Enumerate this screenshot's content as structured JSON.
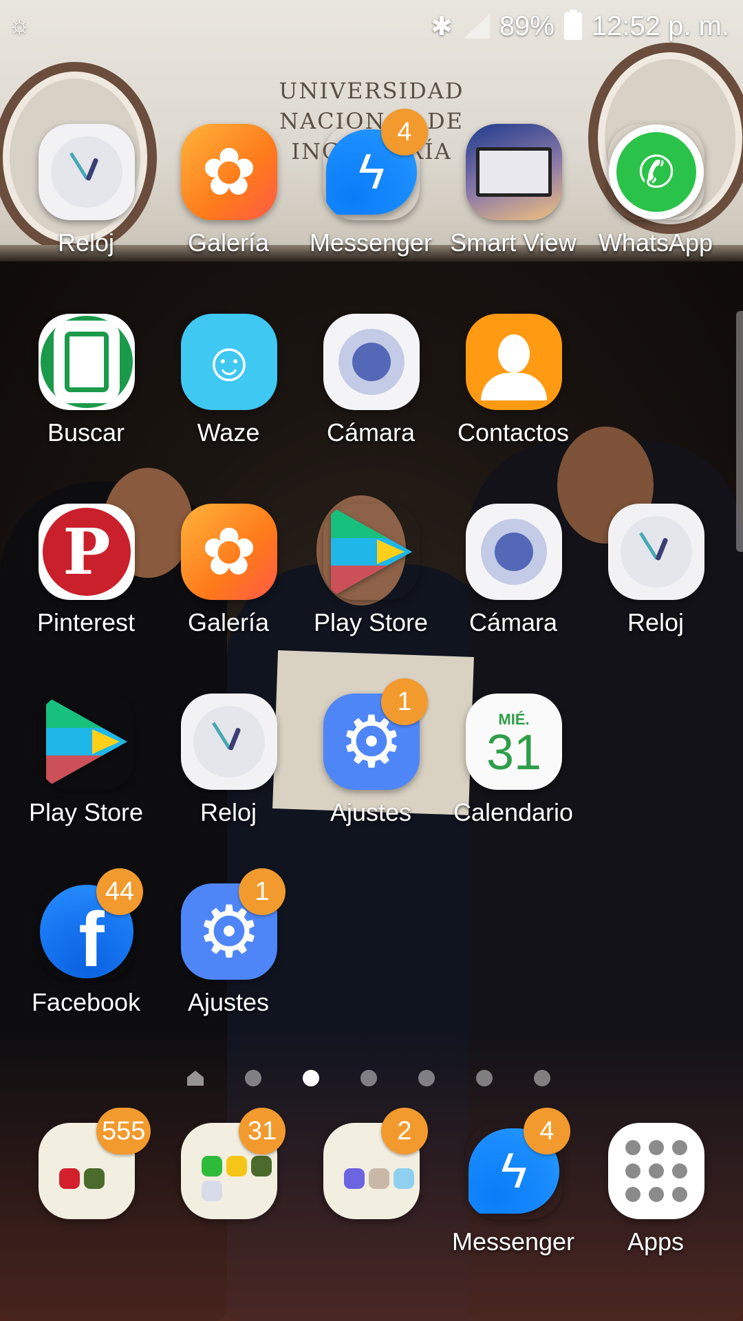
{
  "status_bar": {
    "left_icon": "weather-sun-cloud-icon",
    "bluetooth_icon": "bluetooth-icon",
    "signal_icon": "signal-icon",
    "battery_percent": "89%",
    "time": "12:52 p. m."
  },
  "wallpaper": {
    "banner_text": "UNIVERSIDAD NACIONAL DE INGENIERÍA"
  },
  "home_grid": [
    {
      "label": "Reloj",
      "icon": "clock-icon"
    },
    {
      "label": "Galería",
      "icon": "gallery-icon"
    },
    {
      "label": "Messenger",
      "icon": "messenger-icon",
      "badge": "4"
    },
    {
      "label": "Smart View",
      "icon": "smart-view-icon"
    },
    {
      "label": "WhatsApp",
      "icon": "whatsapp-icon"
    },
    {
      "label": "Buscar",
      "icon": "find-device-icon"
    },
    {
      "label": "Waze",
      "icon": "waze-icon"
    },
    {
      "label": "Cámara",
      "icon": "camera-icon"
    },
    {
      "label": "Contactos",
      "icon": "contacts-icon"
    },
    {
      "label": "Pinterest",
      "icon": "pinterest-icon"
    },
    {
      "label": "Galería",
      "icon": "gallery-icon"
    },
    {
      "label": "Play Store",
      "icon": "play-store-icon"
    },
    {
      "label": "Cámara",
      "icon": "camera-icon"
    },
    {
      "label": "Reloj",
      "icon": "clock-icon"
    },
    {
      "label": "Play Store",
      "icon": "play-store-icon"
    },
    {
      "label": "Reloj",
      "icon": "clock-icon"
    },
    {
      "label": "Ajustes",
      "icon": "settings-gear-icon",
      "badge": "1"
    },
    {
      "label": "Calendario",
      "icon": "calendar-icon",
      "calendar_day": "MIÉ.",
      "calendar_date": "31"
    },
    {
      "label": "Facebook",
      "icon": "facebook-icon",
      "badge": "44"
    },
    {
      "label": "Ajustes",
      "icon": "settings-gear-icon",
      "badge": "1"
    }
  ],
  "page_indicator": {
    "pages": 7,
    "home_page_icon": "home-icon",
    "active_index": 2
  },
  "dock": [
    {
      "label": "",
      "icon": "folder-icon",
      "badge": "555"
    },
    {
      "label": "",
      "icon": "folder-icon",
      "badge": "31"
    },
    {
      "label": "",
      "icon": "folder-icon",
      "badge": "2"
    },
    {
      "label": "Messenger",
      "icon": "messenger-icon",
      "badge": "4"
    },
    {
      "label": "Apps",
      "icon": "apps-grid-icon"
    }
  ],
  "colors": {
    "badge": "#f29a2e",
    "label_text": "#ffffff"
  }
}
